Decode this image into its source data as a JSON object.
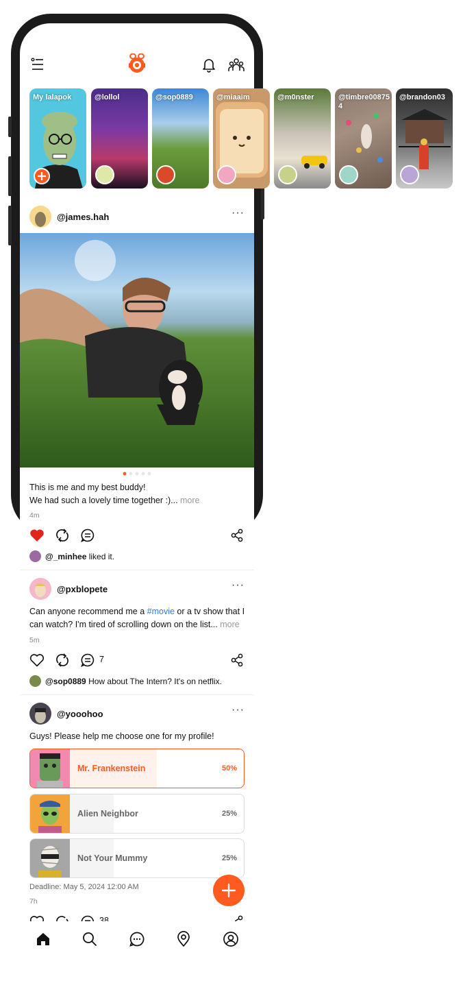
{
  "app": {
    "brand_color": "#ff5a1f",
    "logo": "lalapok-mascot-icon"
  },
  "header": {
    "menu_icon": "menu-icon",
    "notif_icon": "bell-icon",
    "people_icon": "group-icon"
  },
  "stories": [
    {
      "label": "My lalapok"
    },
    {
      "label": "@lollol"
    },
    {
      "label": "@sop0889"
    },
    {
      "label": "@miaaim"
    },
    {
      "label": "@m0nster"
    },
    {
      "label": "@timbre008754"
    },
    {
      "label": "@brandon03"
    }
  ],
  "post1": {
    "user": "@james.hah",
    "more": "···",
    "caption_line1": "This is me and my best buddy!",
    "caption_line2": "We had such a lovely time together :)... ",
    "more_link": "more",
    "time": "4m",
    "liked_by": "@_minhee",
    "liked_text": " liked it.",
    "liked": true,
    "carousel_active": 1,
    "carousel_total": 5
  },
  "post2": {
    "user": "@pxblopete",
    "more": "···",
    "caption_pre": "Can anyone recommend me a ",
    "hashtag": "#movie",
    "caption_post": " or a tv show that I can watch? I'm tired of scrolling down on the list... ",
    "more_link": "more",
    "time": "5m",
    "comment_count": "7",
    "top_comment_user": "@sop0889",
    "top_comment_text": " How about The Intern? It's on netflix."
  },
  "post3": {
    "user": "@yooohoo",
    "more": "···",
    "caption": "Guys! Please help me choose one for my profile!",
    "poll": [
      {
        "label": "Mr. Frankenstein",
        "pct": "50%",
        "value": 0.5
      },
      {
        "label": "Alien Neighbor",
        "pct": "25%",
        "value": 0.25
      },
      {
        "label": "Not Your Mummy",
        "pct": "25%",
        "value": 0.25
      }
    ],
    "deadline": "Deadline: May 5, 2024 12:00 AM",
    "time": "7h",
    "comment_count": "38"
  },
  "tabs": [
    "home-icon",
    "search-icon",
    "chat-icon",
    "location-icon",
    "profile-icon"
  ]
}
